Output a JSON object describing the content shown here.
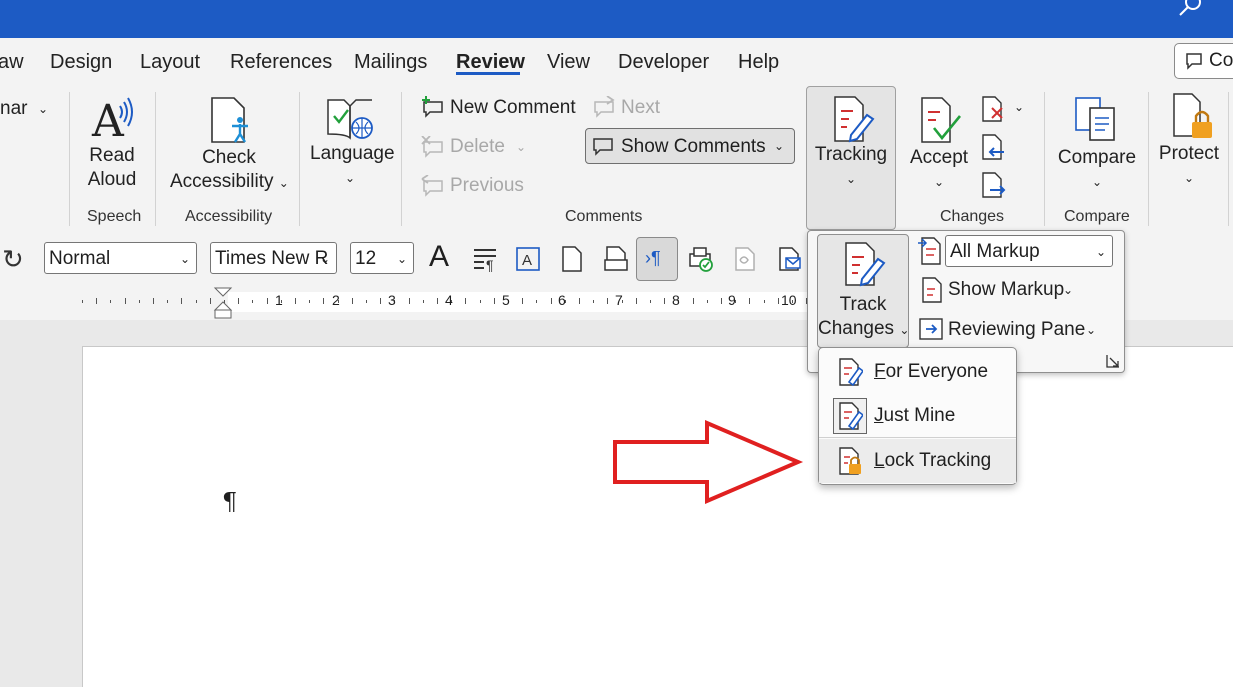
{
  "tabs": [
    "aw",
    "Design",
    "Layout",
    "References",
    "Mailings",
    "Review",
    "View",
    "Developer",
    "Help"
  ],
  "active_tab": "Review",
  "comments_button": "Co",
  "ribbon": {
    "partial_left": "nar",
    "speech": {
      "read_aloud": [
        "Read",
        "Aloud"
      ],
      "group": "Speech"
    },
    "accessibility": {
      "check": "Check",
      "accessibility": "Accessibility",
      "group": "Accessibility"
    },
    "language": {
      "label": "Language"
    },
    "comments": {
      "new_comment": "New Comment",
      "delete": "Delete",
      "previous": "Previous",
      "next": "Next",
      "show_comments": "Show Comments",
      "group": "Comments"
    },
    "tracking": {
      "label": "Tracking"
    },
    "changes": {
      "accept": "Accept",
      "group": "Changes"
    },
    "compare": {
      "label": "Compare",
      "group": "Compare"
    },
    "protect": {
      "label": "Protect"
    }
  },
  "format_bar": {
    "style": "Normal",
    "font": "Times New R",
    "size": "12"
  },
  "ruler": {
    "numbers": [
      "1",
      "2",
      "3",
      "4",
      "5",
      "6",
      "7",
      "8",
      "9",
      "10"
    ]
  },
  "tracking_panel": {
    "track_changes": [
      "Track",
      "Changes"
    ],
    "markup_select": "All Markup",
    "show_markup": "Show Markup",
    "reviewing_pane": "Reviewing Pane"
  },
  "track_menu": {
    "items": [
      {
        "accel": "F",
        "rest": "or Everyone"
      },
      {
        "accel": "J",
        "rest": "ust Mine"
      },
      {
        "accel": "L",
        "rest": "ock Tracking"
      }
    ]
  },
  "document": {
    "pilcrow": "¶"
  },
  "colors": {
    "titlebar": "#1d5bc4",
    "arrow": "#e02020",
    "accent": "#1d5bc4"
  }
}
